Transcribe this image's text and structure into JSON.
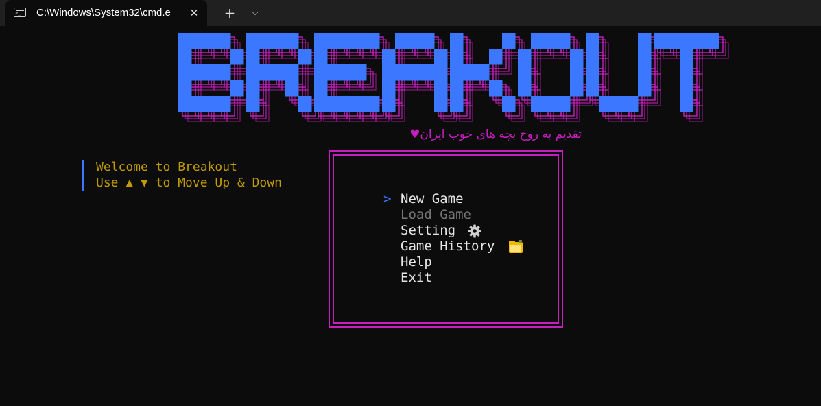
{
  "window": {
    "tab_title": "C:\\Windows\\System32\\cmd.e",
    "close_glyph": "✕",
    "new_tab_glyph": "+",
    "dropdown_glyph": "⌵"
  },
  "logo": {
    "text": "BREAKOUT",
    "front_color": "#3b78ff",
    "shadow_color": "#c71fbf"
  },
  "subtitle": "تقدیم به روح بچه های خوب ایران♥",
  "info": {
    "line1": "Welcome to Breakout",
    "line2": "Use ▲ ▼ to Move Up & Down"
  },
  "menu": {
    "cursor": ">",
    "items": [
      {
        "label": "New Game",
        "state": "selected"
      },
      {
        "label": "Load Game",
        "state": "disabled"
      },
      {
        "label": "Setting",
        "icon": "gear-icon"
      },
      {
        "label": "Game History",
        "icon": "folder-icon"
      },
      {
        "label": "Help"
      },
      {
        "label": "Exit"
      }
    ]
  },
  "colors": {
    "background": "#0c0c0c",
    "info_text": "#c19c00",
    "border": "#c71fbf",
    "cursor": "#3b78ff"
  }
}
